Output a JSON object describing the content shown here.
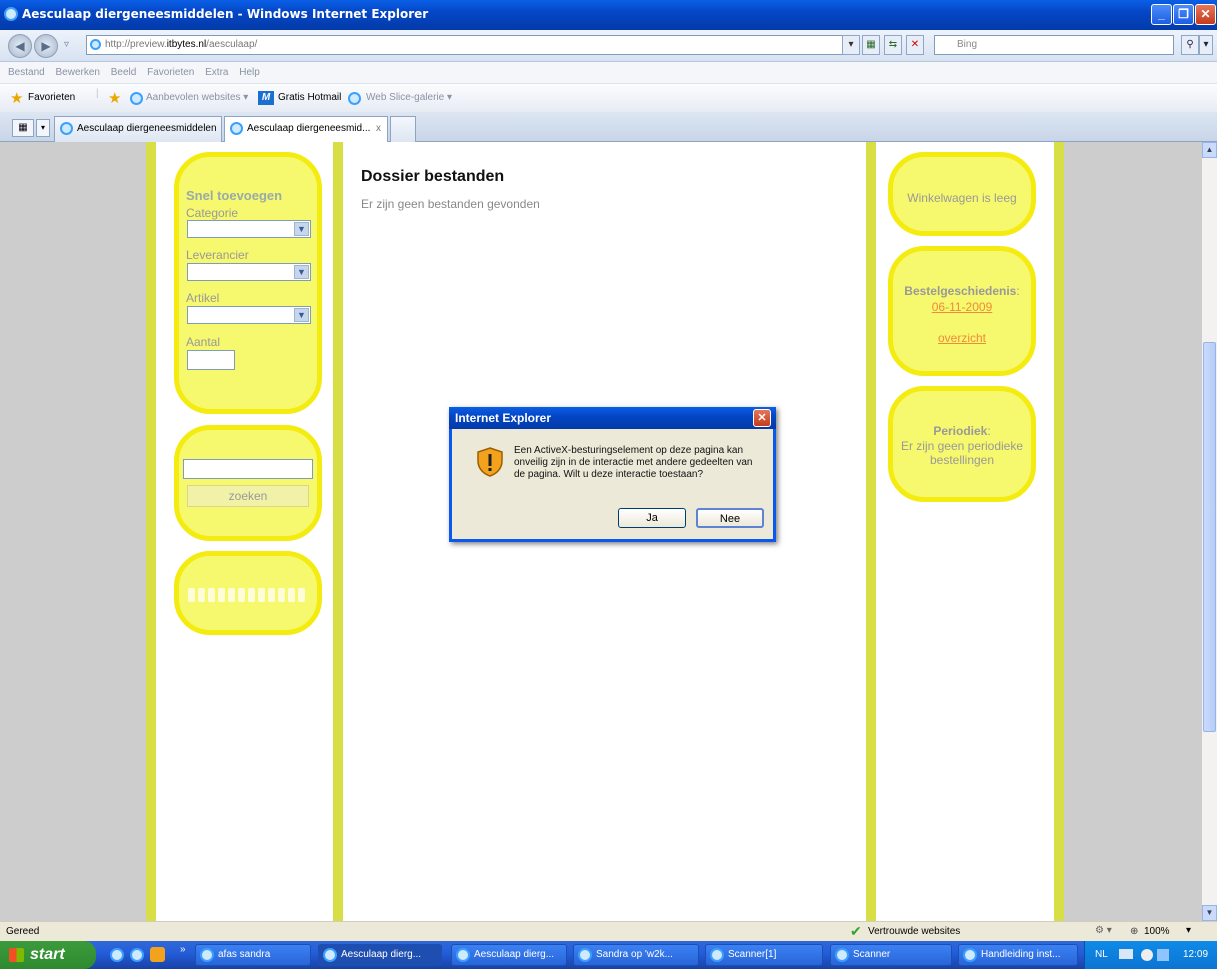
{
  "window": {
    "title": "Aesculaap diergeneesmiddelen - Windows Internet Explorer"
  },
  "address": {
    "prefix": "http://preview.",
    "host": "itbytes.nl",
    "path": "/aesculaap/"
  },
  "search": {
    "placeholder": "Bing"
  },
  "menu": [
    "Bestand",
    "Bewerken",
    "Beeld",
    "Favorieten",
    "Extra",
    "Help"
  ],
  "favorites": {
    "label": "Favorieten",
    "items": [
      "Aanbevolen websites ▾",
      "Gratis Hotmail",
      "Web Slice-galerie ▾"
    ]
  },
  "tabs": [
    {
      "label": "Aesculaap diergeneesmiddelen"
    },
    {
      "label": "Aesculaap diergeneesmid...",
      "close": "x"
    }
  ],
  "left": {
    "title": "Snel toevoegen",
    "categorie": "Categorie",
    "leverancier": "Leverancier",
    "artikel": "Artikel",
    "aantal": "Aantal",
    "search_button": "zoeken"
  },
  "main": {
    "heading": "Dossier bestanden",
    "message": "Er zijn geen bestanden gevonden"
  },
  "right": {
    "cart": "Winkelwagen is leeg",
    "history_title": "Bestelgeschiedenis",
    "history_date": "06-11-2009",
    "overview": "overzicht",
    "periodic_title": "Periodiek",
    "periodic_text": "Er zijn geen periodieke bestellingen"
  },
  "dialog": {
    "title": "Internet Explorer",
    "message": "Een ActiveX-besturingselement op deze pagina kan onveilig zijn in de interactie met andere gedeelten van de pagina. Wilt u deze interactie toestaan?",
    "yes": "Ja",
    "no": "Nee"
  },
  "status": {
    "left": "Gereed",
    "zone": "Vertrouwde websites",
    "zoom": "100%"
  },
  "taskbar": {
    "start": "start",
    "items": [
      "afas sandra",
      "Aesculaap dierg...",
      "Aesculaap dierg...",
      "Sandra op 'w2k...",
      "Scanner[1]",
      "Scanner",
      "Handleiding inst..."
    ],
    "lang": "NL",
    "clock": "12:09"
  },
  "colors": {
    "panel": "#f6f86e",
    "panel_border": "#f4ec10",
    "stripe": "#d8de46",
    "link": "#f08b3b",
    "xp_blue": "#0446c6"
  }
}
